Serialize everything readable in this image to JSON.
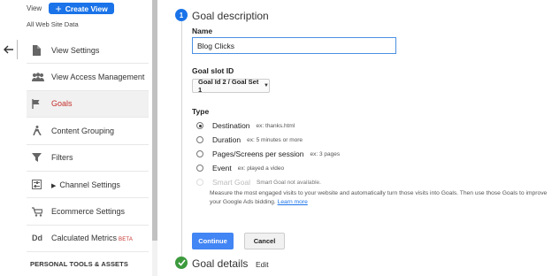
{
  "header": {
    "view_label": "View",
    "create_view_label": "Create View",
    "all_web_site_data": "All Web Site Data"
  },
  "nav": {
    "items": [
      {
        "label": "View Settings",
        "icon": "document-icon"
      },
      {
        "label": "View Access Management",
        "icon": "people-icon"
      },
      {
        "label": "Goals",
        "icon": "flag-icon",
        "active": true
      },
      {
        "label": "Content Grouping",
        "icon": "walker-icon"
      },
      {
        "label": "Filters",
        "icon": "filter-icon"
      },
      {
        "label": "Channel Settings",
        "icon": "settings-box-icon"
      },
      {
        "label": "Ecommerce Settings",
        "icon": "cart-icon"
      },
      {
        "label": "Calculated Metrics",
        "icon": "dd-icon",
        "badge": "BETA"
      }
    ],
    "section_heading": "PERSONAL TOOLS & ASSETS"
  },
  "goal_description": {
    "step_number": "1",
    "title": "Goal description",
    "name_label": "Name",
    "name_value": "Blog Clicks",
    "slot_label": "Goal slot ID",
    "slot_value": "Goal Id 2 / Goal Set 1",
    "type_label": "Type",
    "types": [
      {
        "label": "Destination",
        "example": "ex: thanks.html",
        "selected": true
      },
      {
        "label": "Duration",
        "example": "ex: 5 minutes or more"
      },
      {
        "label": "Pages/Screens per session",
        "example": "ex: 3 pages"
      },
      {
        "label": "Event",
        "example": "ex: played a video"
      },
      {
        "label": "Smart Goal",
        "example": "Smart Goal not available.",
        "disabled": true
      }
    ],
    "smart_goal_description": "Measure the most engaged visits to your website and automatically turn those visits into Goals. Then use those Goals to improve your Google Ads bidding.",
    "learn_more": "Learn more",
    "continue_label": "Continue",
    "cancel_label": "Cancel"
  },
  "goal_details": {
    "title": "Goal details",
    "edit_label": "Edit"
  },
  "colors": {
    "accent": "#1a73e8",
    "active_nav": "#c4302b",
    "success": "#3c9a3c"
  }
}
